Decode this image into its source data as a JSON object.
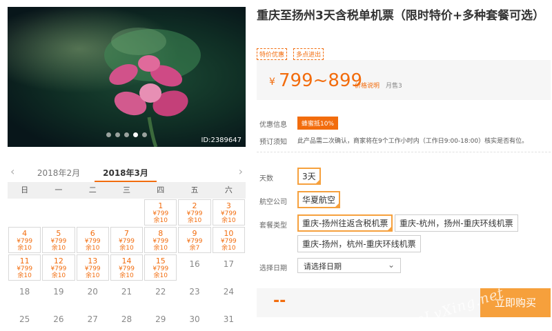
{
  "hero": {
    "image_id": "ID:2389647",
    "dots_total": 5,
    "dots_active_index": 3
  },
  "calendar": {
    "prev_arrow": "‹",
    "next_arrow": "›",
    "prev_month": "2018年2月",
    "current_month": "2018年3月",
    "weekdays": [
      "日",
      "一",
      "二",
      "三",
      "四",
      "五",
      "六"
    ],
    "weeks": [
      [
        null,
        null,
        null,
        null,
        {
          "day": "1",
          "price": "¥799",
          "stock": "余10"
        },
        {
          "day": "2",
          "price": "¥799",
          "stock": "余10"
        },
        {
          "day": "3",
          "price": "¥799",
          "stock": "余10"
        }
      ],
      [
        {
          "day": "4",
          "price": "¥799",
          "stock": "余10"
        },
        {
          "day": "5",
          "price": "¥799",
          "stock": "余10"
        },
        {
          "day": "6",
          "price": "¥799",
          "stock": "余10"
        },
        {
          "day": "7",
          "price": "¥799",
          "stock": "余10"
        },
        {
          "day": "8",
          "price": "¥799",
          "stock": "余10"
        },
        {
          "day": "9",
          "price": "¥799",
          "stock": "余7"
        },
        {
          "day": "10",
          "price": "¥799",
          "stock": "余10"
        }
      ],
      [
        {
          "day": "11",
          "price": "¥799",
          "stock": "余10"
        },
        {
          "day": "12",
          "price": "¥799",
          "stock": "余10"
        },
        {
          "day": "13",
          "price": "¥799",
          "stock": "余10"
        },
        {
          "day": "14",
          "price": "¥799",
          "stock": "余10"
        },
        {
          "day": "15",
          "price": "¥799",
          "stock": "余10"
        },
        {
          "day": "16"
        },
        {
          "day": "17"
        }
      ],
      [
        {
          "day": "18"
        },
        {
          "day": "19"
        },
        {
          "day": "20"
        },
        {
          "day": "21"
        },
        {
          "day": "22"
        },
        {
          "day": "23"
        },
        {
          "day": "24"
        }
      ],
      [
        {
          "day": "25"
        },
        {
          "day": "26"
        },
        {
          "day": "27"
        },
        {
          "day": "28"
        },
        {
          "day": "29"
        },
        {
          "day": "30"
        },
        {
          "day": "31"
        }
      ]
    ]
  },
  "product": {
    "title": "重庆至扬州3天含税单机票（限时特价+多种套餐可选）",
    "tags": [
      "特价优惠",
      "多点进出"
    ],
    "price": {
      "currency": "¥",
      "range": "799~899",
      "explain_link": "价格说明",
      "sold": "月售3"
    },
    "promo": {
      "label": "优惠信息",
      "tag": "蜂蜜抵10%"
    },
    "notice": {
      "label": "预订须知",
      "text": "此产品需二次确认，商家将在9个工作小时内（工作日9:00-18:00）核实是否有位。"
    },
    "days": {
      "label": "天数",
      "options": [
        "3天"
      ]
    },
    "airline": {
      "label": "航空公司",
      "options": [
        "华夏航空"
      ]
    },
    "package": {
      "label": "套餐类型",
      "options": [
        "重庆-扬州往返含税机票",
        "重庆-杭州，扬州-重庆环线机票",
        "重庆-扬州，杭州-重庆环线机票"
      ]
    },
    "date": {
      "label": "选择日期",
      "placeholder": "请选择日期",
      "chevron": "⌄"
    },
    "buy": {
      "total": "--",
      "button": "立即购买"
    }
  },
  "watermark": "eLvXing.net",
  "colors": {
    "accent": "#f26c0d",
    "button": "#f6a03c",
    "selected_border": "#f6a03c"
  }
}
